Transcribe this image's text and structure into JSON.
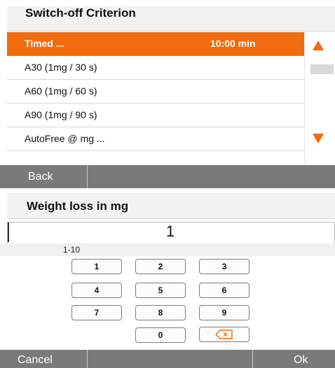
{
  "criterion": {
    "title": "Switch-off Criterion",
    "rows": [
      {
        "label": "Timed ...",
        "value": "10:00 min",
        "selected": true
      },
      {
        "label": "A30  (1mg / 30 s)",
        "value": ""
      },
      {
        "label": "A60  (1mg / 60 s)",
        "value": ""
      },
      {
        "label": "A90  (1mg / 90 s)",
        "value": ""
      },
      {
        "label": "AutoFree @ mg ...",
        "value": ""
      }
    ],
    "scroll_up_icon": "triangle-up-icon",
    "scroll_down_icon": "triangle-down-icon"
  },
  "nav": {
    "back_label": "Back"
  },
  "keypad": {
    "title": "Weight loss in mg",
    "value": "1",
    "range": "1-10",
    "keys": [
      "1",
      "2",
      "3",
      "4",
      "5",
      "6",
      "7",
      "8",
      "9",
      "0"
    ],
    "backspace_icon": "backspace-icon"
  },
  "actions": {
    "cancel_label": "Cancel",
    "ok_label": "Ok"
  },
  "colors": {
    "accent": "#f26b0f",
    "bar": "#7a7a7a",
    "header_bg": "#f2f2f2"
  }
}
